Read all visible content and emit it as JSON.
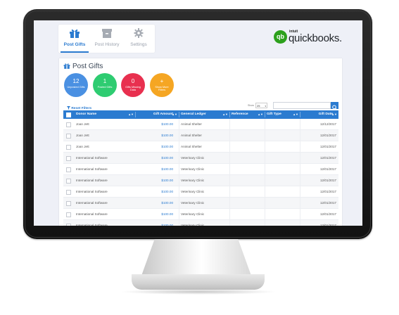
{
  "nav": {
    "tabs": [
      {
        "label": "Post Gifts",
        "icon": "gift-icon",
        "active": true
      },
      {
        "label": "Post History",
        "icon": "archive-box-icon",
        "active": false
      },
      {
        "label": "Settings",
        "icon": "gear-icon",
        "active": false
      }
    ]
  },
  "logo": {
    "badge": "qb",
    "intuit": "intuit",
    "word": "quickbooks."
  },
  "page": {
    "title": "Post Gifts",
    "title_icon": "gift-icon"
  },
  "summary": [
    {
      "value": "12",
      "caption": "Unposted Gifts",
      "color": "#4a90e2"
    },
    {
      "value": "1",
      "caption": "Posted Gifts",
      "color": "#2ecc71"
    },
    {
      "value": "0",
      "caption": "Gifts Missing Data",
      "color": "#e8304f"
    },
    {
      "value": "+",
      "caption": "Show More Filters",
      "color": "#f5a623"
    }
  ],
  "filters": {
    "reset_label": "Reset Filters",
    "show_label": "Show",
    "show_value": "25"
  },
  "table": {
    "columns": [
      "Donor Name",
      "Gift Amount",
      "General Ledger",
      "Reference",
      "Gift Type",
      "Gift Date"
    ],
    "rows": [
      {
        "donor": "Joan Jett",
        "amount": "$100.00",
        "ledger": "Animal Shelter",
        "reference": "",
        "type": "",
        "date": "12/12/2017"
      },
      {
        "donor": "Joan Jett",
        "amount": "$100.00",
        "ledger": "Animal Shelter",
        "reference": "",
        "type": "",
        "date": "12/01/2017"
      },
      {
        "donor": "Joan Jett",
        "amount": "$100.00",
        "ledger": "Animal Shelter",
        "reference": "",
        "type": "",
        "date": "12/01/2017"
      },
      {
        "donor": "International Software",
        "amount": "$100.00",
        "ledger": "Veterinary Clinic",
        "reference": "",
        "type": "",
        "date": "12/01/2017"
      },
      {
        "donor": "International Software",
        "amount": "$100.00",
        "ledger": "Veterinary Clinic",
        "reference": "",
        "type": "",
        "date": "12/01/2017"
      },
      {
        "donor": "International Software",
        "amount": "$100.00",
        "ledger": "Veterinary Clinic",
        "reference": "",
        "type": "",
        "date": "12/01/2017"
      },
      {
        "donor": "International Software",
        "amount": "$100.00",
        "ledger": "Veterinary Clinic",
        "reference": "",
        "type": "",
        "date": "12/01/2017"
      },
      {
        "donor": "International Software",
        "amount": "$100.00",
        "ledger": "Veterinary Clinic",
        "reference": "",
        "type": "",
        "date": "12/01/2017"
      },
      {
        "donor": "International Software",
        "amount": "$100.00",
        "ledger": "Veterinary Clinic",
        "reference": "",
        "type": "",
        "date": "12/01/2017"
      },
      {
        "donor": "International Software",
        "amount": "$100.00",
        "ledger": "Veterinary Clinic",
        "reference": "",
        "type": "",
        "date": "12/01/2017"
      }
    ]
  }
}
